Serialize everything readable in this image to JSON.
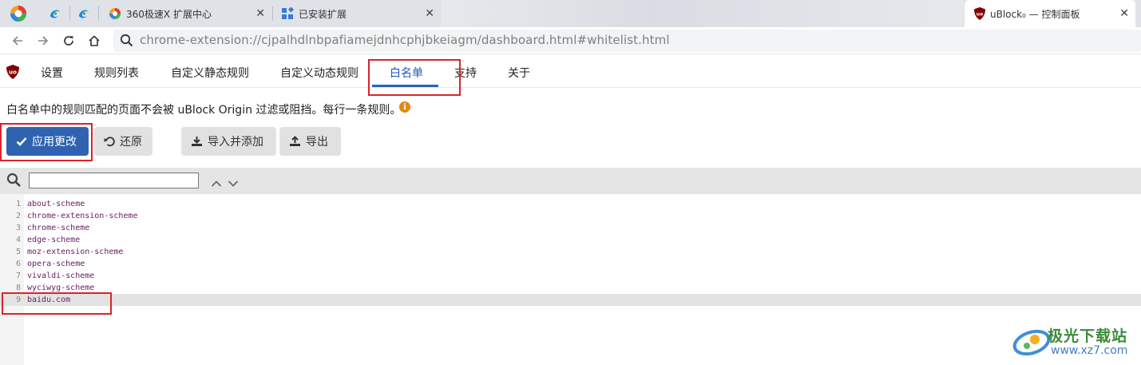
{
  "browser": {
    "tabs": [
      {
        "label": ""
      },
      {
        "label": ""
      },
      {
        "label": "360极速X 扩展中心"
      },
      {
        "label": "已安装扩展"
      },
      {
        "label": "uBlock₀ — 控制面板"
      }
    ],
    "close_glyph": "✕",
    "url": "chrome-extension://cjpalhdlnbpafiamejdnhcphjbkeiagm/dashboard.html#whitelist.html"
  },
  "dashboard": {
    "tabs": [
      "设置",
      "规则列表",
      "自定义静态规则",
      "自定义动态规则",
      "白名单",
      "支持",
      "关于"
    ],
    "selected_tab": "白名单",
    "description": "白名单中的规则匹配的页面不会被 uBlock Origin 过滤或阻挡。每行一条规则。",
    "info_glyph": "i",
    "buttons": {
      "apply": "应用更改",
      "revert": "还原",
      "import": "导入并添加",
      "export": "导出"
    },
    "search": {
      "value": "",
      "placeholder": ""
    }
  },
  "editor": {
    "lines": [
      {
        "num": "1",
        "text": "about-scheme"
      },
      {
        "num": "2",
        "text": "chrome-extension-scheme"
      },
      {
        "num": "3",
        "text": "chrome-scheme"
      },
      {
        "num": "4",
        "text": "edge-scheme"
      },
      {
        "num": "5",
        "text": "moz-extension-scheme"
      },
      {
        "num": "6",
        "text": "opera-scheme"
      },
      {
        "num": "7",
        "text": "vivaldi-scheme"
      },
      {
        "num": "8",
        "text": "wyciwyg-scheme"
      },
      {
        "num": "9",
        "text": "baidu.com"
      }
    ]
  },
  "watermark": {
    "title": "极光下载站",
    "url": "www.xz7.com"
  },
  "colors": {
    "accent": "#2f63b2",
    "highlight_box": "#d9232a",
    "code_text": "#6a1a60"
  }
}
